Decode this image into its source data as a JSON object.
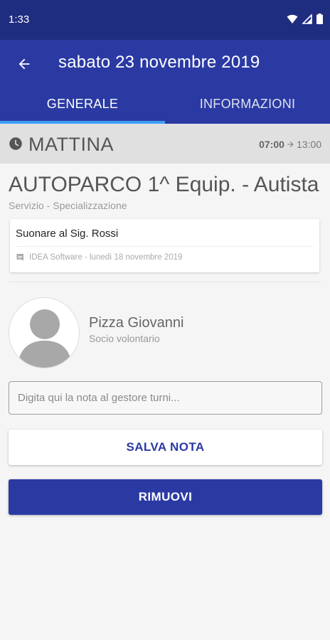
{
  "status_bar": {
    "time": "1:33",
    "icons": [
      "wifi-icon",
      "signal-icon",
      "battery-icon"
    ]
  },
  "app_bar": {
    "back_icon": "arrow-back-icon",
    "title": "sabato 23 novembre 2019"
  },
  "tabs": [
    {
      "label": "GENERALE",
      "selected": true
    },
    {
      "label": "INFORMAZIONI",
      "selected": false
    }
  ],
  "shift": {
    "icon": "clock-icon",
    "label": "MATTINA",
    "start": "07:00",
    "arrow_icon": "arrow-right-icon",
    "end": "13:00"
  },
  "service": {
    "title": "AUTOPARCO 1^ Equip. - Autista",
    "subtitle": "Servizio - Specializzazione"
  },
  "note": {
    "text": "Suonare al Sig. Rossi",
    "meta_icon": "comment-icon",
    "meta": "IDEA Software - lunedì 18 novembre 2019"
  },
  "person": {
    "avatar_icon": "person-placeholder-icon",
    "name": "Pizza Giovanni",
    "role": "Socio volontario"
  },
  "note_input": {
    "placeholder": "Digita qui la nota al gestore turni...",
    "value": ""
  },
  "buttons": {
    "save": "SALVA NOTA",
    "remove": "RIMUOVI"
  },
  "colors": {
    "status_bar": "#1f2d80",
    "primary": "#2b3aa3",
    "tab_indicator": "#3f9df5",
    "shift_header_bg": "#e0e0e0"
  }
}
